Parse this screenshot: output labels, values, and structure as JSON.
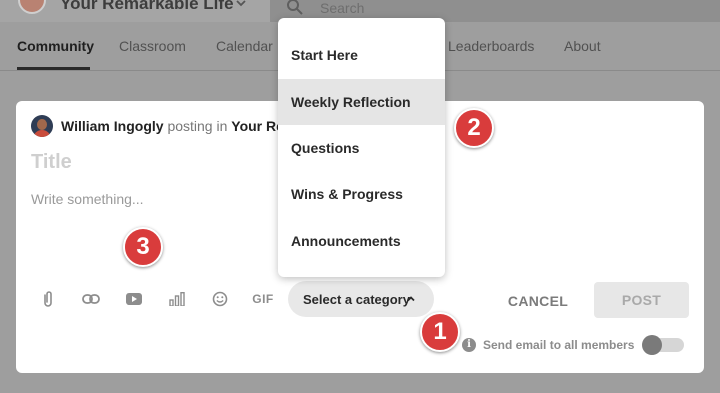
{
  "header": {
    "group_name": "Your Remarkable Life",
    "search_placeholder": "Search"
  },
  "nav": {
    "tabs": [
      {
        "label": "Community",
        "active": true
      },
      {
        "label": "Classroom",
        "active": false
      },
      {
        "label": "Calendar",
        "active": false
      },
      {
        "label": "Leaderboards",
        "active": false
      },
      {
        "label": "About",
        "active": false
      }
    ]
  },
  "composer": {
    "author": "William Ingogly",
    "posting_in": "posting in",
    "group": "Your Re",
    "title_placeholder": "Title",
    "body_placeholder": "Write something...",
    "toolbar": [
      {
        "icon": "paperclip-icon"
      },
      {
        "icon": "link-icon"
      },
      {
        "icon": "youtube-icon"
      },
      {
        "icon": "poll-icon"
      },
      {
        "icon": "emoji-icon"
      },
      {
        "icon": "gif-icon",
        "label": "GIF"
      }
    ],
    "category_select": "Select a category",
    "cancel": "CANCEL",
    "post": "POST",
    "email_label": "Send email to all members",
    "email_toggle_on": false
  },
  "dropdown": {
    "items": [
      "Start Here",
      "Weekly Reflection",
      "Questions",
      "Wins & Progress",
      "Announcements"
    ],
    "highlighted": "Weekly Reflection"
  },
  "annotations": [
    "1",
    "2",
    "3"
  ],
  "colors": {
    "badge": "#d93c3c",
    "highlight": "#e5e5e5",
    "overlay": "#9e9e9e"
  }
}
